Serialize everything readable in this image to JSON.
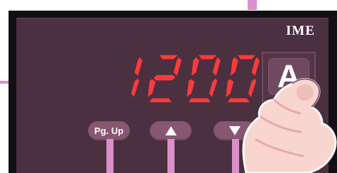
{
  "device": {
    "brand": "IME",
    "display_value": "1200",
    "unit": "A"
  },
  "buttons": {
    "page_up_label": "Pg. Up",
    "up_icon": "triangle-up-icon",
    "down_icon": "triangle-down-icon"
  },
  "colors": {
    "panel": "#4b3040",
    "bezel": "#121014",
    "segment_red": "#ff3a3a",
    "button": "#87576f",
    "pointer_lines": "#d98fc9",
    "hand": "#f8d5cf"
  }
}
